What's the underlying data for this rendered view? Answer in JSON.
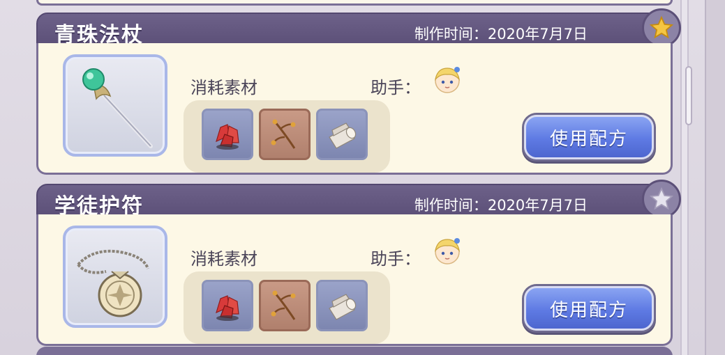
{
  "recipes": [
    {
      "title": "青珠法杖",
      "date": "制作时间：2020年7月7日",
      "favorite": true,
      "item_icon": "staff-icon",
      "materials_label": "消耗素材",
      "helper_label": "助手：",
      "materials": [
        "red-crystal-icon",
        "branch-icon",
        "wood-log-icon"
      ],
      "button_label": "使用配方"
    },
    {
      "title": "学徒护符",
      "date": "制作时间：2020年7月7日",
      "favorite": false,
      "item_icon": "amulet-icon",
      "materials_label": "消耗素材",
      "helper_label": "助手：",
      "materials": [
        "red-crystal-icon",
        "branch-icon",
        "wood-log-icon"
      ],
      "button_label": "使用配方"
    }
  ],
  "colors": {
    "header": "#5c5078",
    "card_body": "#fdf8e6",
    "button": "#5e7ae3",
    "star_gold": "#f5c542",
    "star_grey": "#e6e3ee"
  }
}
